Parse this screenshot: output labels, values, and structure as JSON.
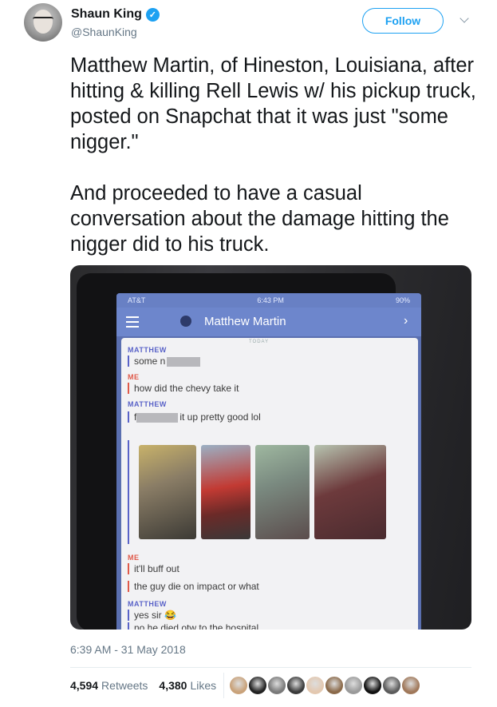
{
  "author": {
    "display_name": "Shaun King",
    "handle": "@ShaunKing",
    "verified": true
  },
  "follow_label": "Follow",
  "tweet": {
    "paragraphs": [
      "Matthew Martin, of Hineston, Louisiana, after hitting & killing Rell Lewis w/ his pickup truck, posted on Snapchat that it was just \"some nigger.\"",
      "And proceeded to have a casual conversation about the damage hitting the nigger did to his truck."
    ],
    "timestamp": "6:39 AM - 31 May 2018"
  },
  "media": {
    "status_carrier": "AT&T",
    "status_time": "6:43 PM",
    "status_battery": "90%",
    "chat_title": "Matthew Martin",
    "today_label": "TODAY",
    "messages": [
      {
        "sender": "MATTHEW",
        "text": "some n"
      },
      {
        "sender": "ME",
        "text": "how did the chevy take it"
      },
      {
        "sender": "MATTHEW",
        "text": "it up pretty good lol",
        "prefix": "f"
      },
      {
        "sender": "ME",
        "text": "it'll buff out"
      },
      {
        "sender": "",
        "text": "the guy die on impact or what"
      },
      {
        "sender": "MATTHEW",
        "text": "yes sir"
      },
      {
        "sender": "",
        "text": "no he died otw to the hospital"
      }
    ]
  },
  "stats": {
    "retweets_count": "4,594",
    "retweets_label": "Retweets",
    "likes_count": "4,380",
    "likes_label": "Likes"
  },
  "likers_count": 10,
  "colors": {
    "accent": "#1da1f2",
    "text": "#14171a",
    "muted": "#657786"
  }
}
